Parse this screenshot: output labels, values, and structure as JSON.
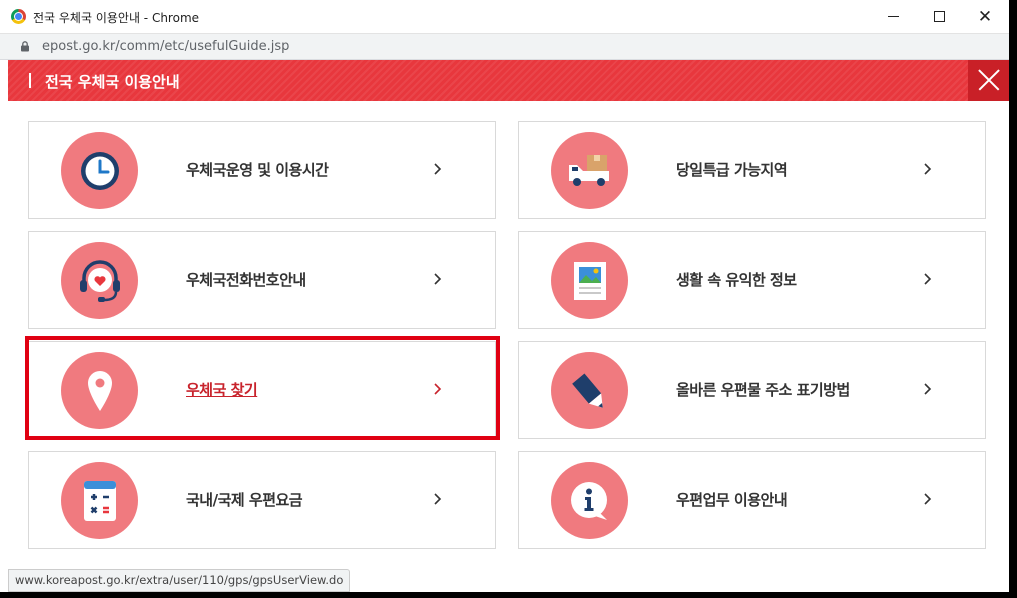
{
  "window": {
    "title": "전국 우체국 이용안내 - Chrome",
    "controls": {
      "minimize": "–",
      "maximize": "☐",
      "close": "✕"
    }
  },
  "addressbar": {
    "url": "epost.go.kr/comm/etc/usefulGuide.jsp"
  },
  "header": {
    "title": "전국 우체국 이용안내"
  },
  "cards": [
    {
      "label": "우체국운영 및 이용시간",
      "icon": "clock-icon"
    },
    {
      "label": "당일특급 가능지역",
      "icon": "delivery-truck-icon"
    },
    {
      "label": "우체국전화번호안내",
      "icon": "headset-icon"
    },
    {
      "label": "생활 속 유익한 정보",
      "icon": "picture-document-icon"
    },
    {
      "label": "우체국 찾기",
      "icon": "location-pin-icon"
    },
    {
      "label": "올바른 우편물 주소 표기방법",
      "icon": "pencil-icon"
    },
    {
      "label": "국내/국제 우편요금",
      "icon": "calculator-icon"
    },
    {
      "label": "우편업무 이용안내",
      "icon": "info-bubble-icon"
    }
  ],
  "statusbar": {
    "text": "www.koreapost.go.kr/extra/user/110/gps/gpsUserView.do"
  },
  "colors": {
    "header_red": "#e8373d",
    "icon_circle": "#f07a7f",
    "highlight_red": "#e00012",
    "active_label": "#c8232c"
  }
}
